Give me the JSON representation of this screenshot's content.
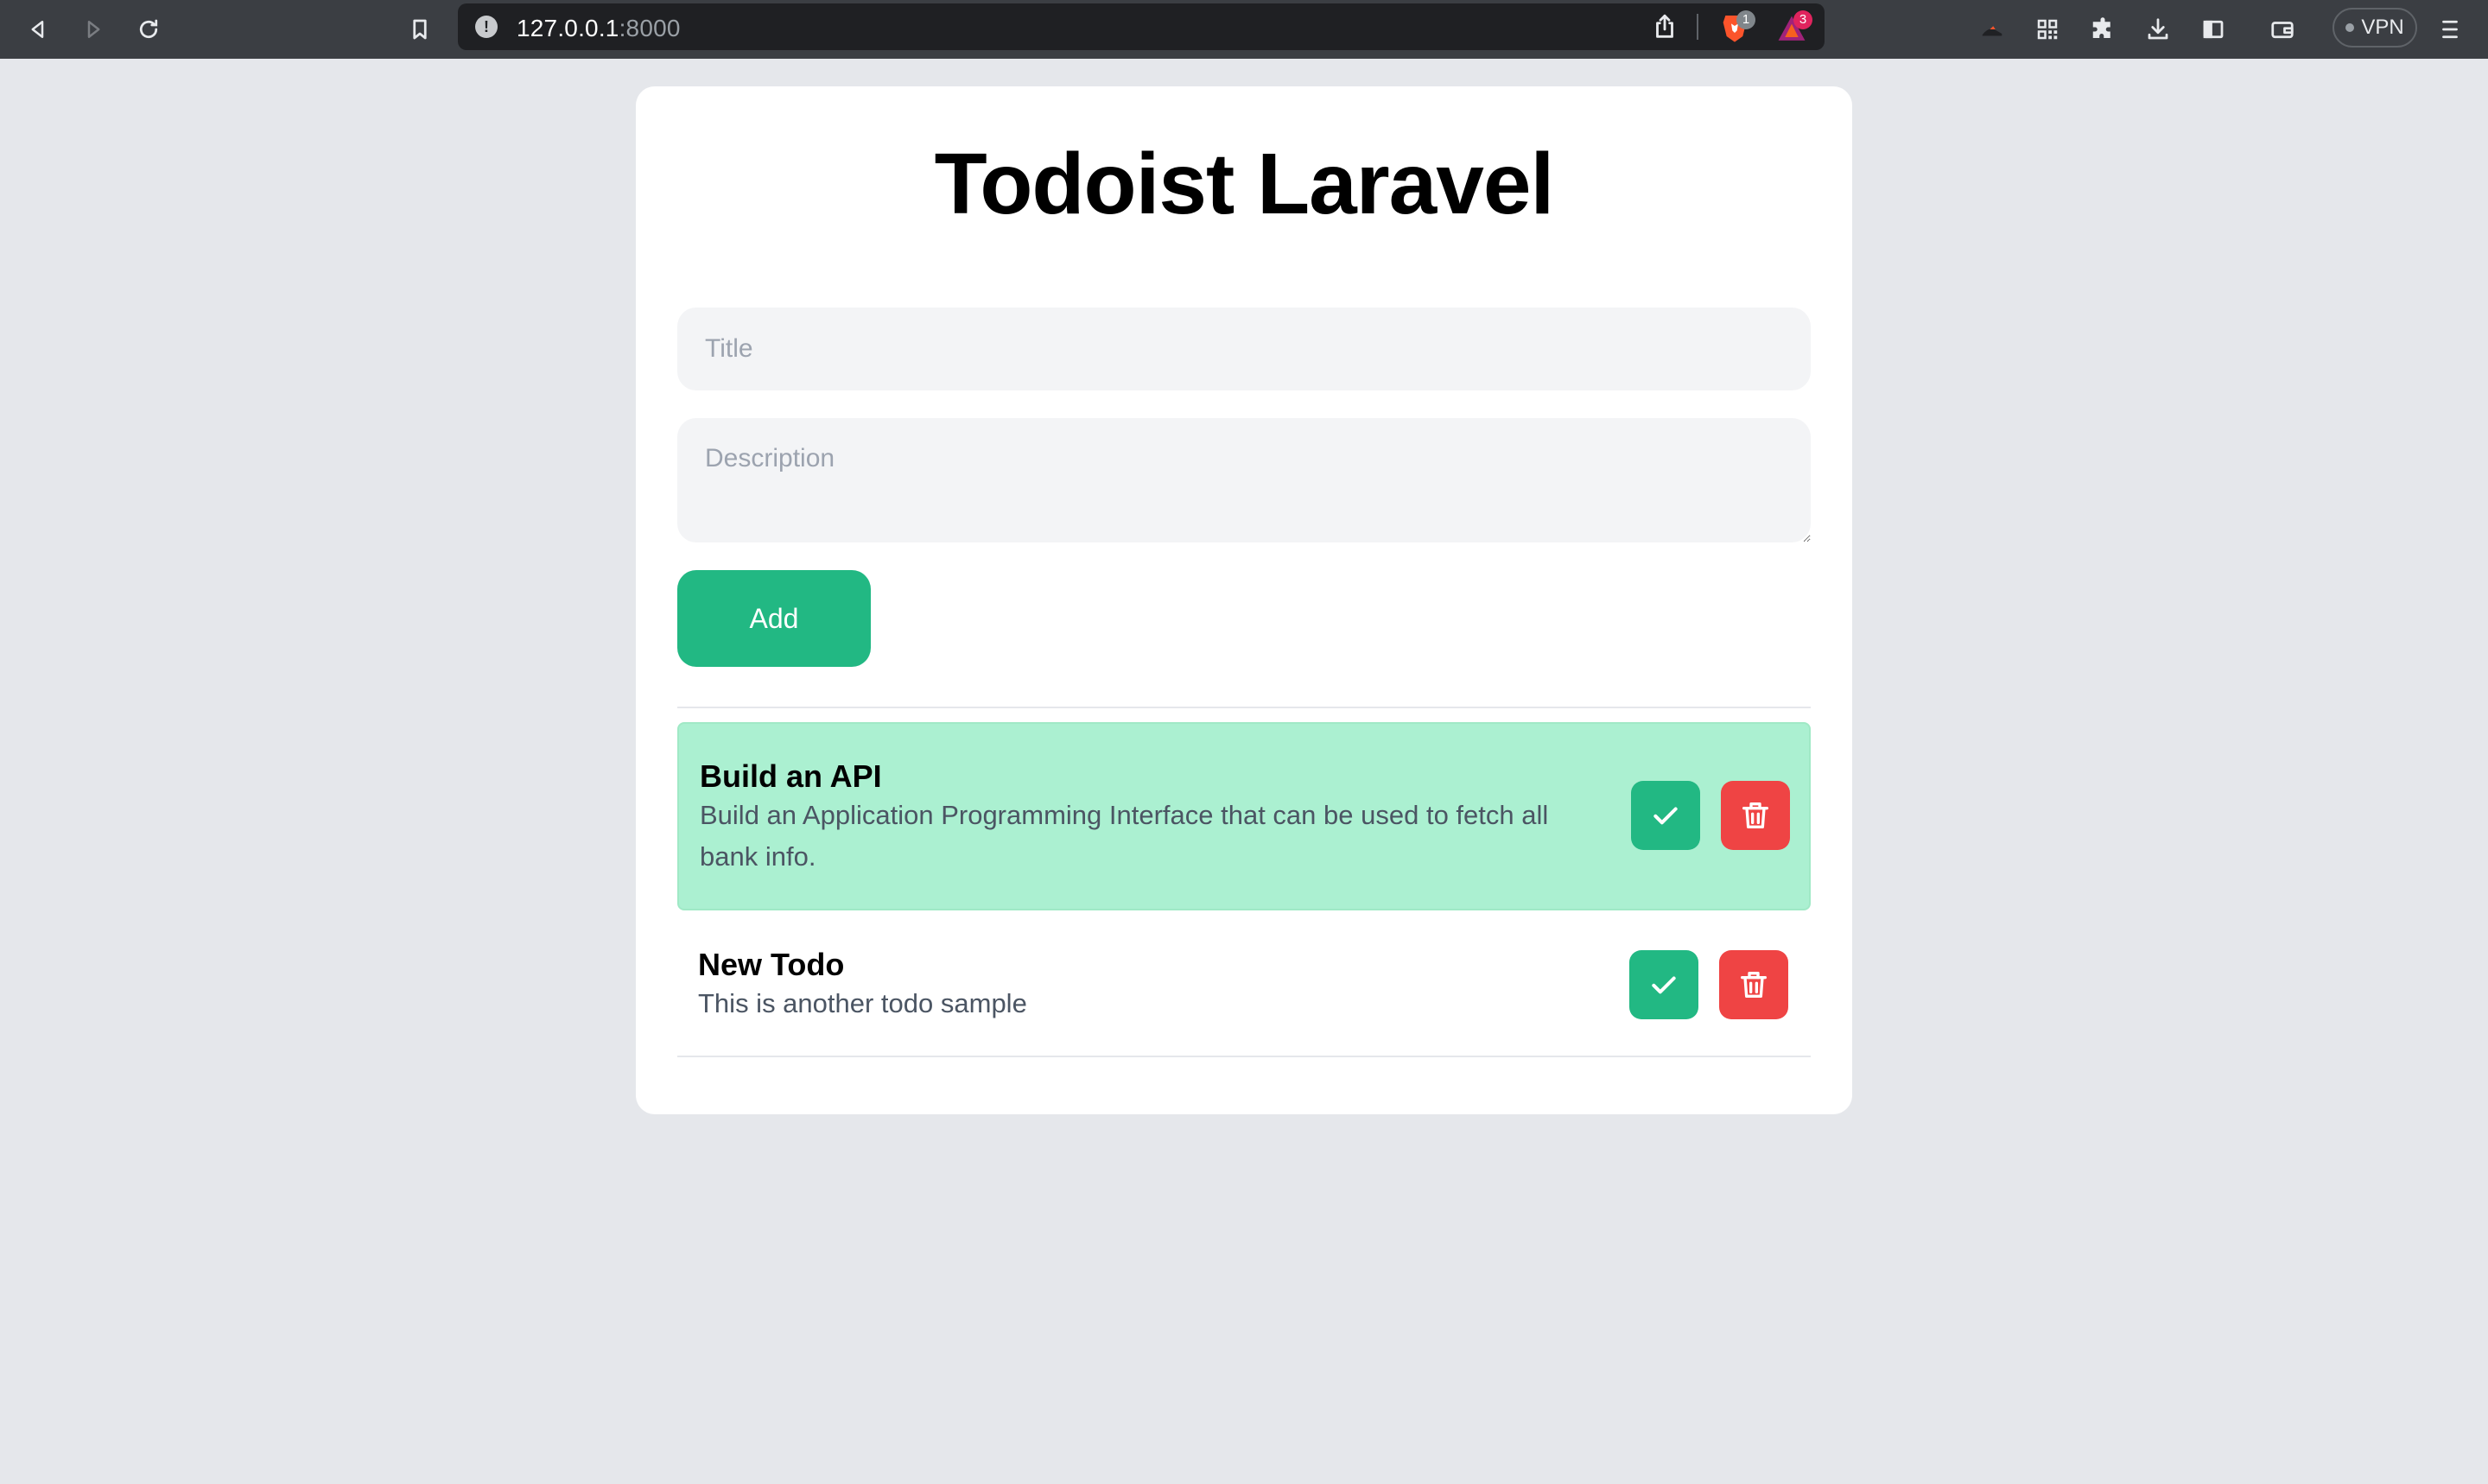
{
  "browser": {
    "url_host": "127.0.0.1",
    "url_port": ":8000",
    "brave_shields_count": "1",
    "brave_rewards_count": "3",
    "vpn_label": "VPN"
  },
  "app": {
    "title": "Todoist Laravel",
    "form": {
      "title_placeholder": "Title",
      "title_value": "",
      "description_placeholder": "Description",
      "description_value": "",
      "add_label": "Add"
    },
    "todos": [
      {
        "title": "Build an API",
        "description": "Build an Application Programming Interface that can be used to fetch all bank info.",
        "completed": true
      },
      {
        "title": "New Todo",
        "description": "This is another todo sample",
        "completed": false
      }
    ]
  },
  "colors": {
    "page_bg": "#e5e7eb",
    "accent_green": "#22b883",
    "done_row_bg": "#abf0d1",
    "delete_red": "#ef4444"
  }
}
